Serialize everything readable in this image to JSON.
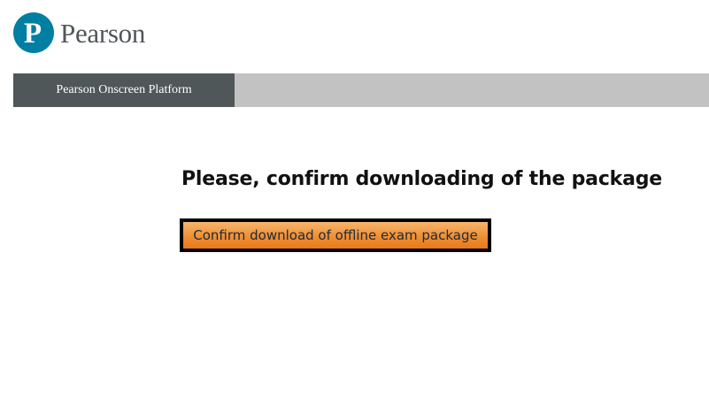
{
  "header": {
    "logo_text": "Pearson",
    "logo_glyph": "P",
    "brand_color": "#007fa3"
  },
  "nav": {
    "tab_label": "Pearson Onscreen Platform"
  },
  "main": {
    "heading": "Please, confirm downloading of the package",
    "confirm_button_label": "Confirm download of offline exam package",
    "button_color": "#ef8f34"
  }
}
